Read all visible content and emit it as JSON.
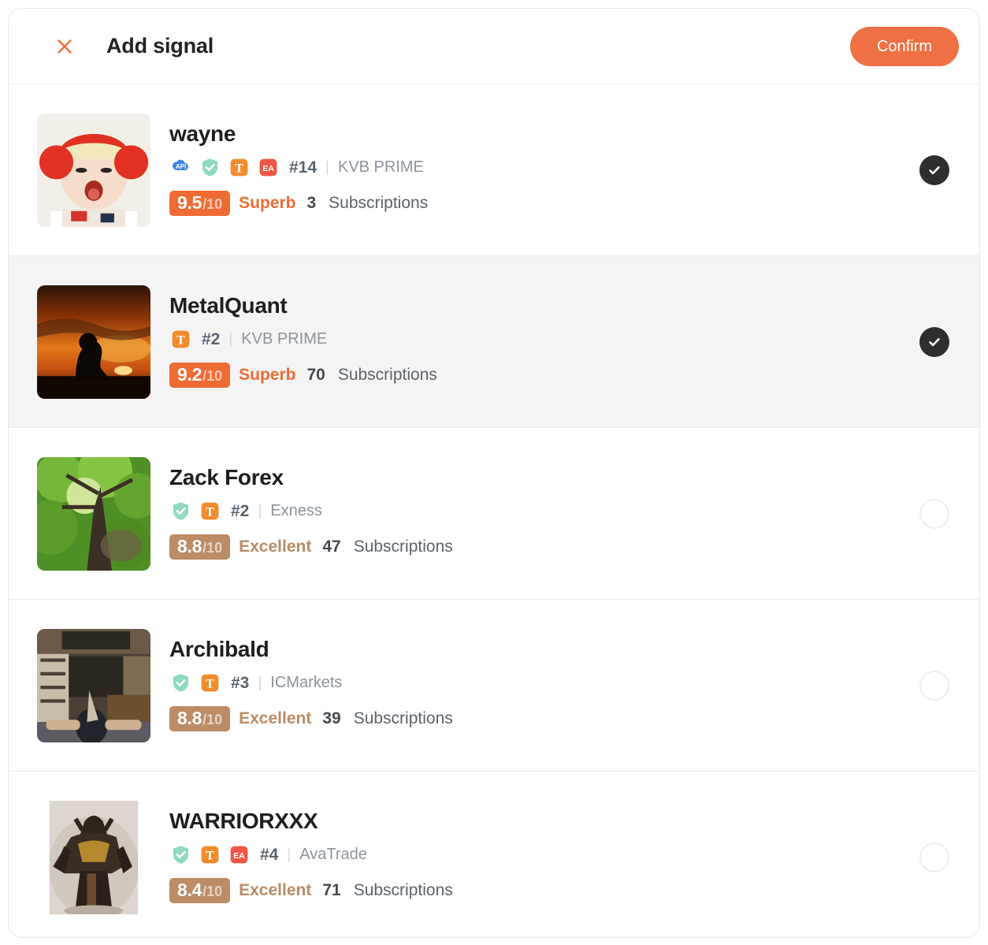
{
  "header": {
    "title": "Add signal",
    "close_icon": "close-x-icon",
    "confirm_label": "Confirm",
    "confirm_color": "#ef7044"
  },
  "colors": {
    "superb": "#ef6b34",
    "excellent": "#bb8c66",
    "chip_superb_bg": "#ef6b34",
    "chip_excellent_bg": "#bb8c66",
    "selected_row_bg": "#f4f4f4",
    "selected_dot_bg": "#2e2e2e"
  },
  "badges": {
    "api": {
      "name": "api-badge-icon",
      "label": "API",
      "color": "#3d83e8"
    },
    "verified": {
      "name": "verified-shield-icon",
      "label": "",
      "color": "#8fd9c0"
    },
    "t": {
      "name": "t-badge-icon",
      "label": "T",
      "color": "#f08c2e"
    },
    "ea": {
      "name": "ea-badge-icon",
      "label": "EA",
      "color": "#ef5744"
    }
  },
  "list": {
    "rows": [
      {
        "name": "wayne",
        "avatar": "baby-in-red-hat-photo",
        "badges": [
          "api",
          "verified",
          "t",
          "ea"
        ],
        "rank": "#14",
        "separator": "|",
        "broker": "KVB PRIME",
        "score": "9.5",
        "score_denominator": "/10",
        "rating_label": "Superb",
        "rating_kind": "superb",
        "subscriptions_count": "3",
        "subscriptions_word": "Subscriptions",
        "selected": true,
        "highlighted": false
      },
      {
        "name": "MetalQuant",
        "avatar": "sunset-silhouette-photo",
        "badges": [
          "t"
        ],
        "rank": "#2",
        "separator": "|",
        "broker": "KVB PRIME",
        "score": "9.2",
        "score_denominator": "/10",
        "rating_label": "Superb",
        "rating_kind": "superb",
        "subscriptions_count": "70",
        "subscriptions_word": "Subscriptions",
        "selected": true,
        "highlighted": true
      },
      {
        "name": "Zack Forex",
        "avatar": "green-tree-canopy-photo",
        "badges": [
          "verified",
          "t"
        ],
        "rank": "#2",
        "separator": "|",
        "broker": "Exness",
        "score": "8.8",
        "score_denominator": "/10",
        "rating_label": "Excellent",
        "rating_kind": "excellent",
        "subscriptions_count": "47",
        "subscriptions_word": "Subscriptions",
        "selected": false,
        "highlighted": false
      },
      {
        "name": "Archibald",
        "avatar": "workshop-interior-photo",
        "badges": [
          "verified",
          "t"
        ],
        "rank": "#3",
        "separator": "|",
        "broker": "ICMarkets",
        "score": "8.8",
        "score_denominator": "/10",
        "rating_label": "Excellent",
        "rating_kind": "excellent",
        "subscriptions_count": "39",
        "subscriptions_word": "Subscriptions",
        "selected": false,
        "highlighted": false
      },
      {
        "name": "WARRIORXXX",
        "avatar": "armored-warrior-artwork-photo",
        "badges": [
          "verified",
          "t",
          "ea"
        ],
        "rank": "#4",
        "separator": "|",
        "broker": "AvaTrade",
        "score": "8.4",
        "score_denominator": "/10",
        "rating_label": "Excellent",
        "rating_kind": "excellent",
        "subscriptions_count": "71",
        "subscriptions_word": "Subscriptions",
        "selected": false,
        "highlighted": false
      }
    ]
  }
}
